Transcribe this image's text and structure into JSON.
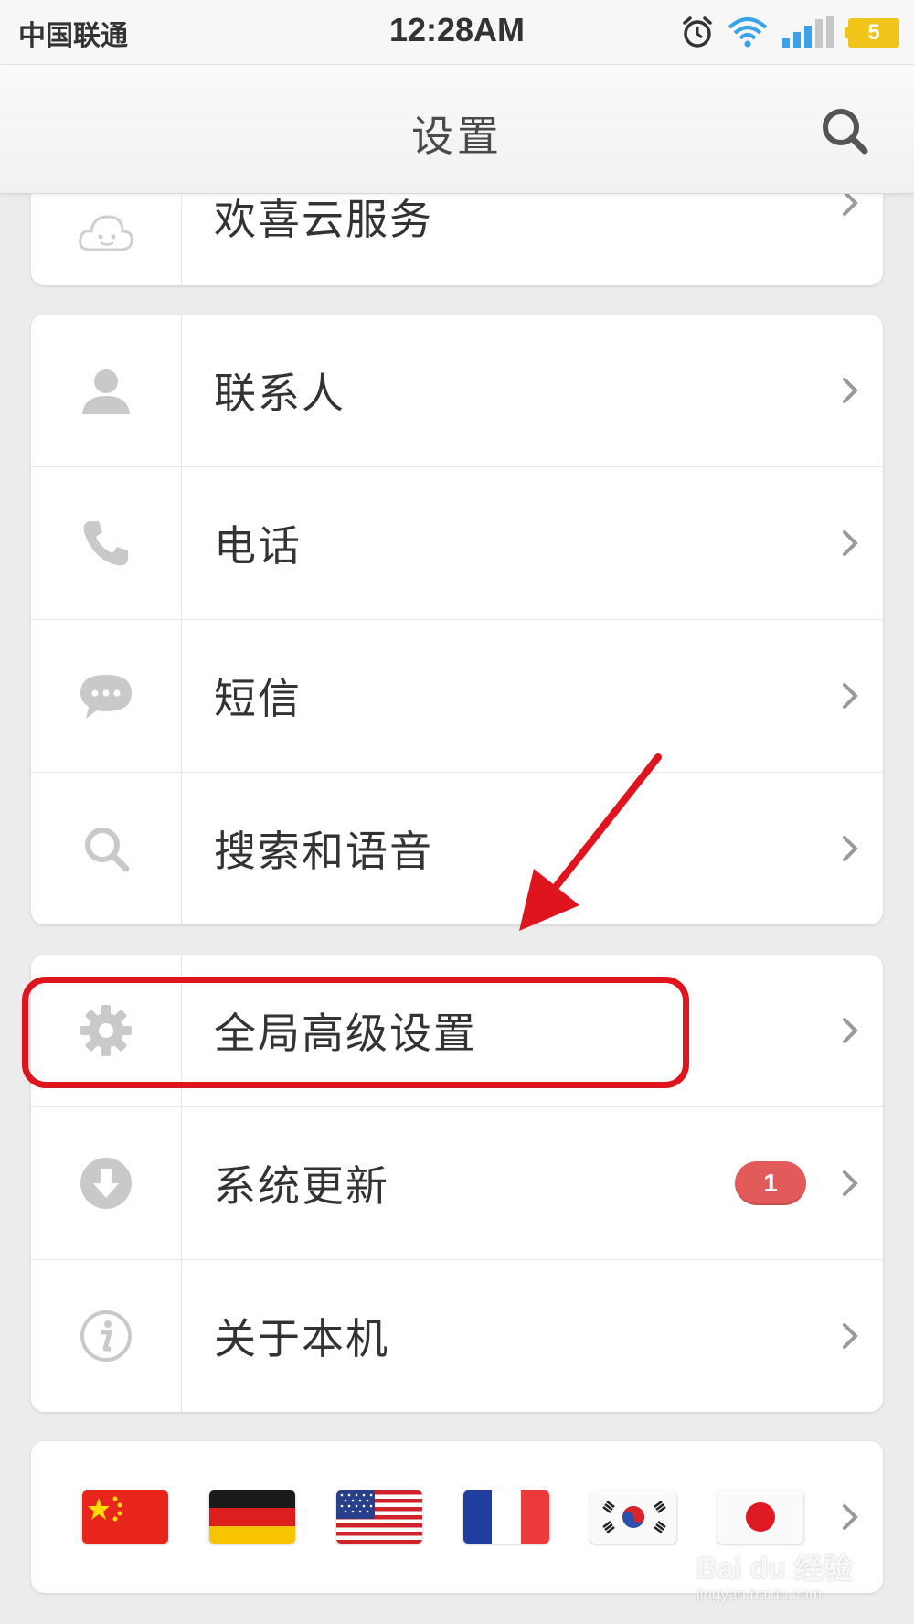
{
  "status_bar": {
    "carrier": "中国联通",
    "time": "12:28AM",
    "battery": "5"
  },
  "header": {
    "title": "设置"
  },
  "card_top": {
    "items": [
      {
        "label": "欢喜云服务",
        "icon": "cloud-icon"
      }
    ]
  },
  "card_apps": {
    "items": [
      {
        "label": "联系人",
        "icon": "person-icon"
      },
      {
        "label": "电话",
        "icon": "phone-icon"
      },
      {
        "label": "短信",
        "icon": "message-icon"
      },
      {
        "label": "搜索和语音",
        "icon": "search-icon"
      }
    ]
  },
  "card_system": {
    "items": [
      {
        "label": "全局高级设置",
        "icon": "gear-icon"
      },
      {
        "label": "系统更新",
        "icon": "download-icon",
        "badge": "1"
      },
      {
        "label": "关于本机",
        "icon": "info-icon"
      }
    ]
  },
  "language_flags": [
    "china-flag",
    "germany-flag",
    "usa-flag",
    "france-flag",
    "korea-flag",
    "japan-flag"
  ],
  "watermark": {
    "brand": "Bai du 经验",
    "url": "jingyan.baidu.com"
  },
  "colors": {
    "accent_red": "#e0141e",
    "badge": "#e25a5a",
    "battery": "#f0c418"
  }
}
